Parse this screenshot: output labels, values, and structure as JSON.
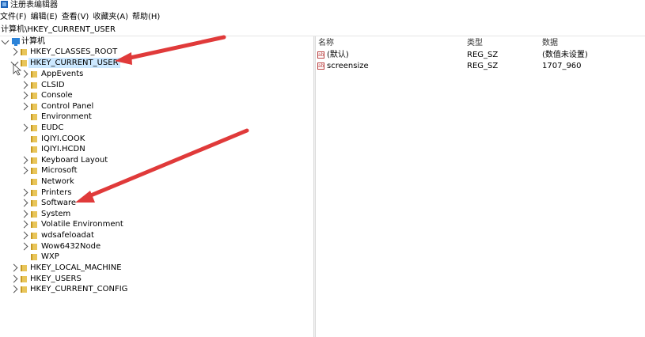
{
  "window": {
    "title": "注册表编辑器"
  },
  "menu": [
    "文件(F)",
    "编辑(E)",
    "查看(V)",
    "收藏夹(A)",
    "帮助(H)"
  ],
  "address": "计算机\\HKEY_CURRENT_USER",
  "tree": {
    "root": "计算机",
    "hives": {
      "classes_root": "HKEY_CLASSES_ROOT",
      "current_user": "HKEY_CURRENT_USER",
      "local_machine": "HKEY_LOCAL_MACHINE",
      "users": "HKEY_USERS",
      "current_config": "HKEY_CURRENT_CONFIG"
    },
    "current_user_children": [
      "AppEvents",
      "CLSID",
      "Console",
      "Control Panel",
      "Environment",
      "EUDC",
      "IQIYI.COOK",
      "IQIYI.HCDN",
      "Keyboard Layout",
      "Microsoft",
      "Network",
      "Printers",
      "Software",
      "System",
      "Volatile Environment",
      "wdsafeloadat",
      "Wow6432Node",
      "WXP"
    ]
  },
  "list": {
    "columns": {
      "name": "名称",
      "type": "类型",
      "data": "数据"
    },
    "rows": [
      {
        "icon": "ab",
        "name": "(默认)",
        "type": "REG_SZ",
        "data": "(数值未设置)"
      },
      {
        "icon": "ab",
        "name": "screensize",
        "type": "REG_SZ",
        "data": "1707_960"
      }
    ]
  },
  "colors": {
    "annotation_arrow": "#e03a3a",
    "selection": "#cce8ff"
  }
}
